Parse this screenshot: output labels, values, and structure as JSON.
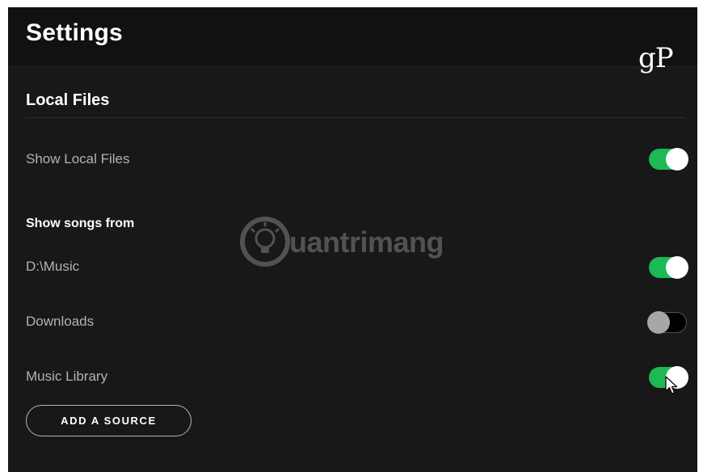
{
  "header": {
    "title": "Settings",
    "brand_logo_text": "gP"
  },
  "local_files": {
    "section_title": "Local Files",
    "show_local_files": {
      "label": "Show Local Files",
      "enabled": true
    },
    "show_songs_from_header": "Show songs from",
    "sources": [
      {
        "label": "D:\\Music",
        "enabled": true
      },
      {
        "label": "Downloads",
        "enabled": false
      },
      {
        "label": "Music Library",
        "enabled": true
      }
    ],
    "add_source_label": "ADD A SOURCE"
  },
  "watermark": {
    "text": "uantrimang"
  },
  "colors": {
    "background": "#181818",
    "header_background": "#111111",
    "toggle_on": "#1db954",
    "toggle_off": "#000000",
    "text_primary": "#ffffff",
    "text_secondary": "#b3b3b3"
  },
  "icons": {
    "cursor": "mouse-pointer-icon",
    "watermark_logo": "lightbulb-icon"
  }
}
